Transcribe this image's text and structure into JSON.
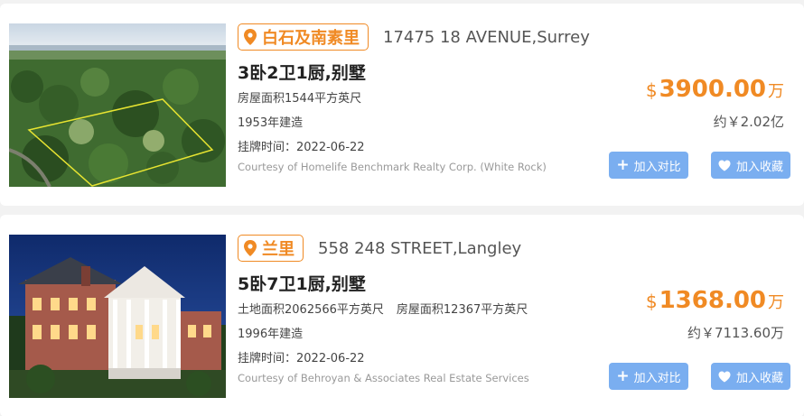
{
  "listings": [
    {
      "region": "白石及南素里",
      "address": "17475 18 AVENUE,Surrey",
      "title": "3卧2卫1厨,别墅",
      "area_line_1": "房屋面积1544平方英尺",
      "area_line_2": "",
      "year_built": "1953年建造",
      "listing_date": "挂牌时间：2022-06-22",
      "courtesy": "Courtesy of Homelife Benchmark Realty Corp. (White Rock)",
      "price_currency": "$",
      "price_value": "3900.00",
      "price_unit": "万",
      "price_rmb": "约￥2.02亿",
      "compare_label": "加入对比",
      "favorite_label": "加入收藏",
      "photo_icon": "aerial-land-photo"
    },
    {
      "region": "兰里",
      "address": "558 248 STREET,Langley",
      "title": "5卧7卫1厨,别墅",
      "area_line_1": "土地面积2062566平方英尺",
      "area_line_2": "房屋面积12367平方英尺",
      "year_built": "1996年建造",
      "listing_date": "挂牌时间：2022-06-22",
      "courtesy": "Courtesy of Behroyan & Associates Real Estate Services",
      "price_currency": "$",
      "price_value": "1368.00",
      "price_unit": "万",
      "price_rmb": "约￥7113.60万",
      "compare_label": "加入对比",
      "favorite_label": "加入收藏",
      "photo_icon": "mansion-night-photo"
    }
  ],
  "colors": {
    "accent_orange": "#f08a24",
    "button_blue": "#7aaef0",
    "page_background": "#f2f2f2"
  }
}
